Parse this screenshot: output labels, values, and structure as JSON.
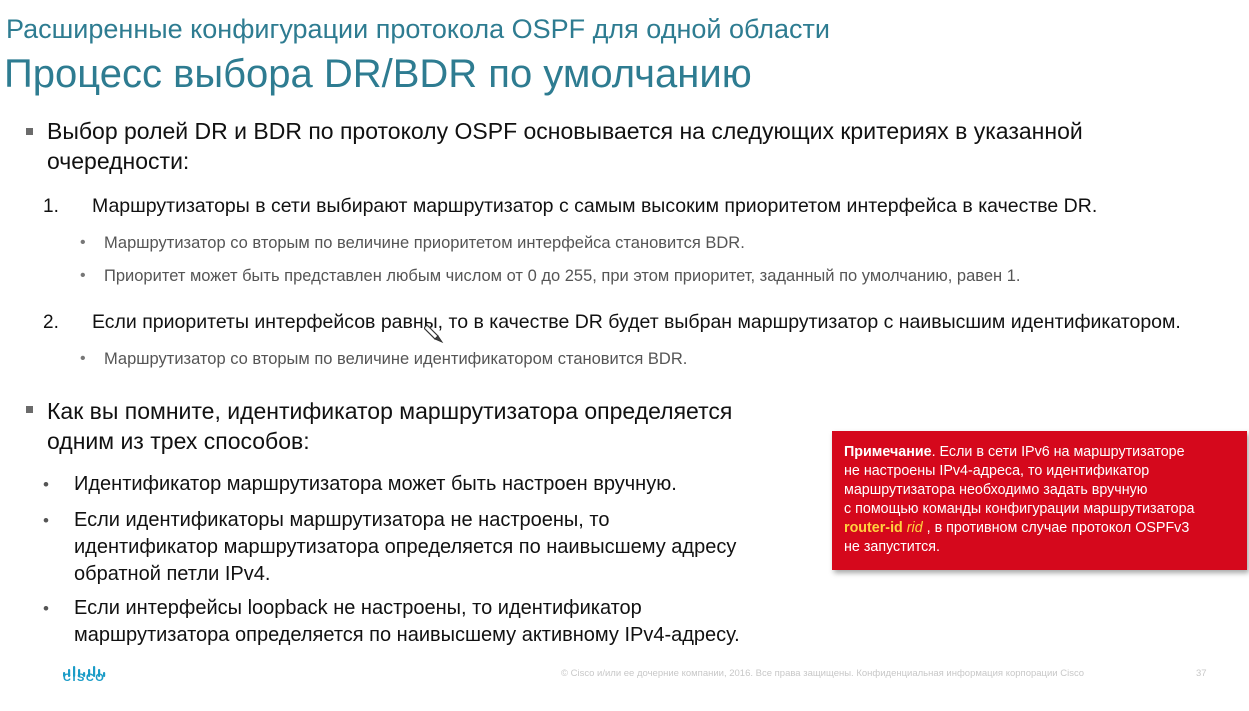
{
  "header": {
    "subtitle": "Расширенные конфигурации протокола OSPF для одной области",
    "title": "Процесс выбора DR/BDR по умолчанию"
  },
  "intro": {
    "line1": "Выбор ролей DR и BDR по протоколу OSPF основывается на следующих критериях в указанной",
    "line2": "очередности:"
  },
  "criteria": [
    {
      "num": "1.",
      "text": "Маршрутизаторы в сети выбирают маршрутизатор с самым высоким приоритетом интерфейса в качестве DR.",
      "subs": [
        "Маршрутизатор со вторым по величине приоритетом интерфейса становится BDR.",
        "Приоритет может быть представлен любым числом от 0 до 255, при этом приоритет, заданный по умолчанию, равен 1."
      ]
    },
    {
      "num": "2.",
      "text": "Если приоритеты интерфейсов равны, то в качестве DR будет выбран маршрутизатор с наивысшим идентификатором.",
      "subs": [
        "Маршрутизатор со вторым по величине идентификатором становится BDR."
      ]
    }
  ],
  "routerid": {
    "line1": "Как вы помните, идентификатор маршрутизатора определяется",
    "line2": "одним из трех способов:",
    "items": [
      {
        "lines": [
          "Идентификатор маршрутизатора может быть настроен вручную."
        ]
      },
      {
        "lines": [
          "Если идентификаторы маршрутизатора не настроены, то",
          "идентификатор маршрутизатора определяется по наивысшему адресу",
          "обратной петли IPv4."
        ]
      },
      {
        "lines": [
          "Если интерфейсы loopback не настроены, то идентификатор",
          "маршрутизатора определяется по наивысшему активному IPv4-адресу."
        ]
      }
    ]
  },
  "note": {
    "label": "Примечание",
    "line1_rest": ". Если в сети IPv6 на маршрутизаторе",
    "line2": "не настроены IPv4-адреса, то идентификатор",
    "line3": "маршрутизатора необходимо задать вручную",
    "line4": "с помощью команды конфигурации маршрутизатора",
    "cmd": "router-id",
    "arg": "rid",
    "line5_rest": " , в противном случае протокол OSPFv3",
    "line6": "не запустится.",
    "bg_color": "#d5081c",
    "highlight_color": "#ffd23f"
  },
  "footer": {
    "logo_text": "CISCO",
    "copyright": "© Cisco и/или ее дочерние компании, 2016. Все права защищены. Конфиденциальная информация корпорации Cisco",
    "page_number": "37"
  }
}
